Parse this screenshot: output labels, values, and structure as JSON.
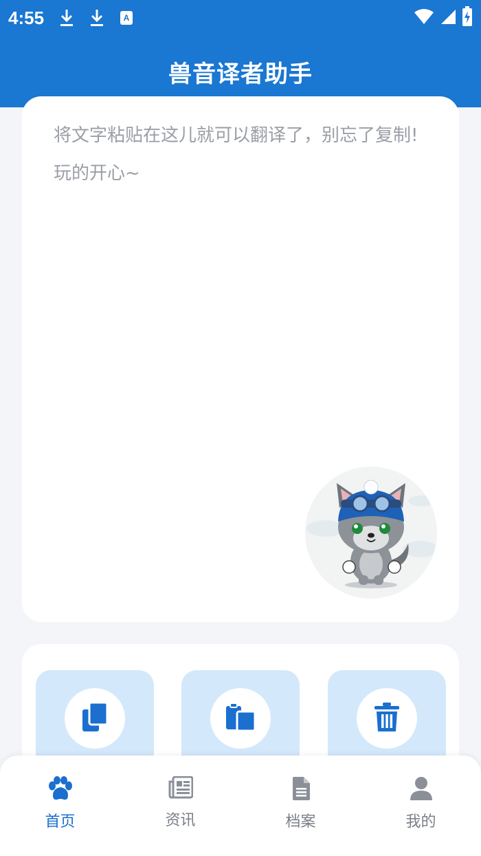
{
  "status_bar": {
    "time": "4:55",
    "icons": [
      "download-icon",
      "download-icon",
      "keyboard-a-icon",
      "wifi-icon",
      "signal-icon",
      "battery-charging-icon"
    ]
  },
  "app_bar": {
    "title": "兽音译者助手"
  },
  "input": {
    "placeholder": "将文字粘贴在这儿就可以翻译了，别忘了复制!\n玩的开心~"
  },
  "actions": [
    {
      "icon": "copy-icon"
    },
    {
      "icon": "paste-icon"
    },
    {
      "icon": "trash-icon"
    }
  ],
  "bottom_nav": {
    "items": [
      {
        "label": "首页",
        "icon": "paw-icon",
        "active": true
      },
      {
        "label": "资讯",
        "icon": "news-icon",
        "active": false
      },
      {
        "label": "档案",
        "icon": "document-icon",
        "active": false
      },
      {
        "label": "我的",
        "icon": "person-icon",
        "active": false
      }
    ]
  },
  "colors": {
    "primary": "#1a77d2",
    "action_bg": "#d3e8fb",
    "icon_blue": "#1a6fcf",
    "inactive": "#7a7f88",
    "background": "#f3f5f9"
  }
}
